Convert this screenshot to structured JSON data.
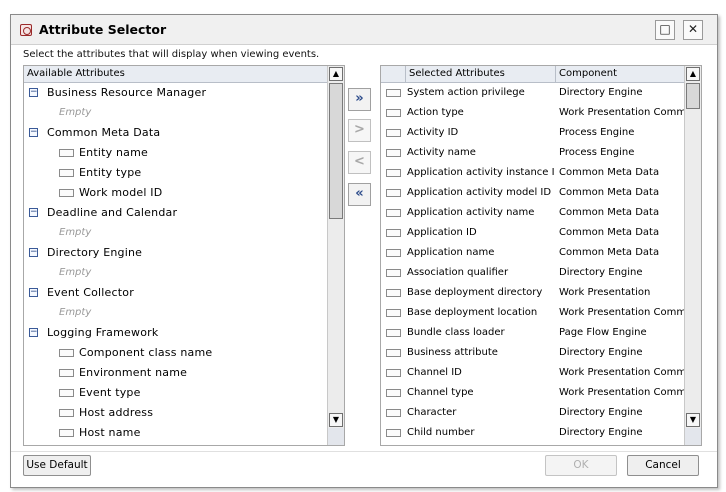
{
  "window": {
    "title": "Attribute Selector",
    "icon": "attribute-selector-app-icon",
    "maximize_glyph": "□",
    "close_glyph": "✕"
  },
  "instructions": "Select the attributes that will display when viewing events.",
  "available": {
    "header": "Available Attributes",
    "rows": [
      {
        "type": "group",
        "label": "Business Resource Manager",
        "expander": "−"
      },
      {
        "type": "empty",
        "label": "Empty"
      },
      {
        "type": "group",
        "label": "Common Meta Data",
        "expander": "−"
      },
      {
        "type": "leaf",
        "label": "Entity name"
      },
      {
        "type": "leaf",
        "label": "Entity type"
      },
      {
        "type": "leaf",
        "label": "Work model ID"
      },
      {
        "type": "group",
        "label": "Deadline and Calendar",
        "expander": "−"
      },
      {
        "type": "empty",
        "label": "Empty"
      },
      {
        "type": "group",
        "label": "Directory Engine",
        "expander": "−"
      },
      {
        "type": "empty",
        "label": "Empty"
      },
      {
        "type": "group",
        "label": "Event Collector",
        "expander": "−"
      },
      {
        "type": "empty",
        "label": "Empty"
      },
      {
        "type": "group",
        "label": "Logging Framework",
        "expander": "−"
      },
      {
        "type": "leaf",
        "label": "Component class name"
      },
      {
        "type": "leaf",
        "label": "Environment name"
      },
      {
        "type": "leaf",
        "label": "Event type"
      },
      {
        "type": "leaf",
        "label": "Host address"
      },
      {
        "type": "leaf",
        "label": "Host name"
      }
    ]
  },
  "transfer": {
    "add_all": "»",
    "add": ">",
    "remove": "<",
    "remove_all": "«"
  },
  "selected": {
    "columns": [
      "Selected Attributes",
      "Component"
    ],
    "rows": [
      [
        "System action privilege",
        "Directory Engine"
      ],
      [
        "Action type",
        "Work Presentation Commo"
      ],
      [
        "Activity ID",
        "Process Engine"
      ],
      [
        "Activity name",
        "Process Engine"
      ],
      [
        "Application activity instance ID",
        "Common Meta Data"
      ],
      [
        "Application activity model ID",
        "Common Meta Data"
      ],
      [
        "Application activity name",
        "Common Meta Data"
      ],
      [
        "Application ID",
        "Common Meta Data"
      ],
      [
        "Application name",
        "Common Meta Data"
      ],
      [
        "Association qualifier",
        "Directory Engine"
      ],
      [
        "Base deployment directory",
        "Work Presentation"
      ],
      [
        "Base deployment location",
        "Work Presentation Commo"
      ],
      [
        "Bundle class loader",
        "Page Flow Engine"
      ],
      [
        "Business attribute",
        "Directory Engine"
      ],
      [
        "Channel ID",
        "Work Presentation Commo"
      ],
      [
        "Channel type",
        "Work Presentation Commo"
      ],
      [
        "Character",
        "Directory Engine"
      ],
      [
        "Child number",
        "Directory Engine"
      ]
    ]
  },
  "scroll": {
    "up_glyph": "▲",
    "down_glyph": "▼"
  },
  "buttons": {
    "use_default": "Use Default",
    "ok": "OK",
    "cancel": "Cancel"
  }
}
